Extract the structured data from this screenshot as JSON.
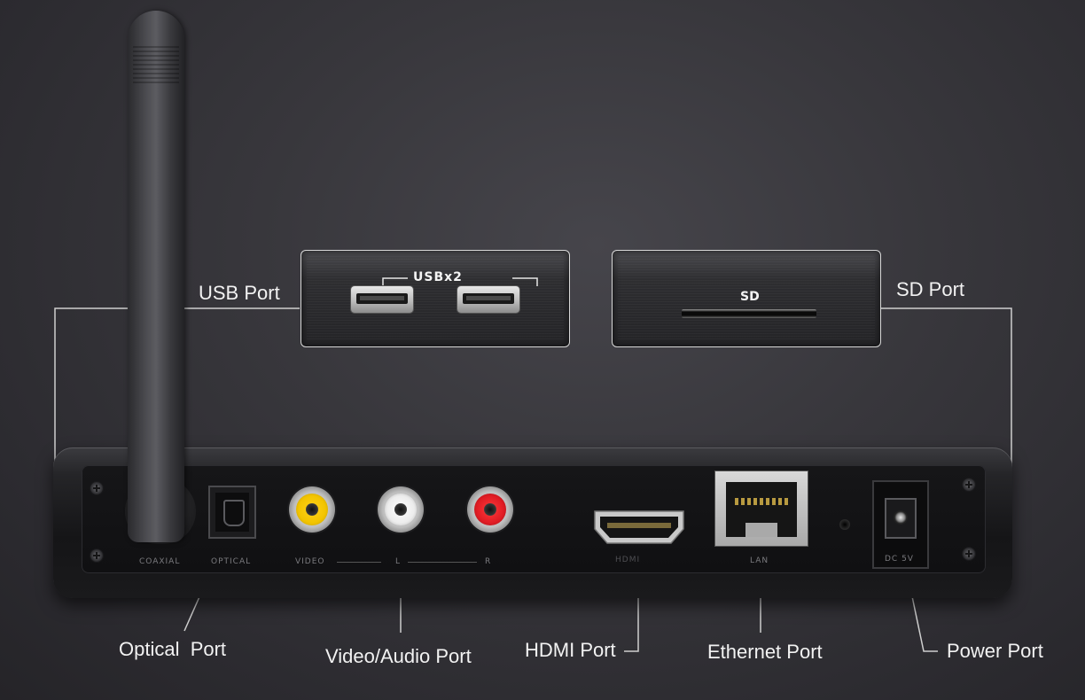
{
  "colors": {
    "background": "#38373c",
    "device": "#1e1e21",
    "label_text": "#f2f2f2",
    "leader_line": "#d0d0d0",
    "rca_video": "#f2c400",
    "rca_left": "#f4f4f4",
    "rca_right": "#e01c24"
  },
  "callouts": {
    "usb_port": "USB Port",
    "sd_port": "SD Port",
    "optical_port": "Optical  Port",
    "video_audio_port": "Video/Audio Port",
    "hdmi_port": "HDMI Port",
    "ethernet_port": "Ethernet Port",
    "power_port": "Power Port"
  },
  "zoom_panels": {
    "usb_caption": "USBx2",
    "sd_caption": "SD"
  },
  "panel_markings": {
    "coaxial": "COAXIAL",
    "optical": "OPTICAL",
    "video": "VIDEO",
    "left": "L",
    "right": "R",
    "hdmi": "HDMI",
    "lan": "LAN",
    "dc": "DC 5V"
  }
}
